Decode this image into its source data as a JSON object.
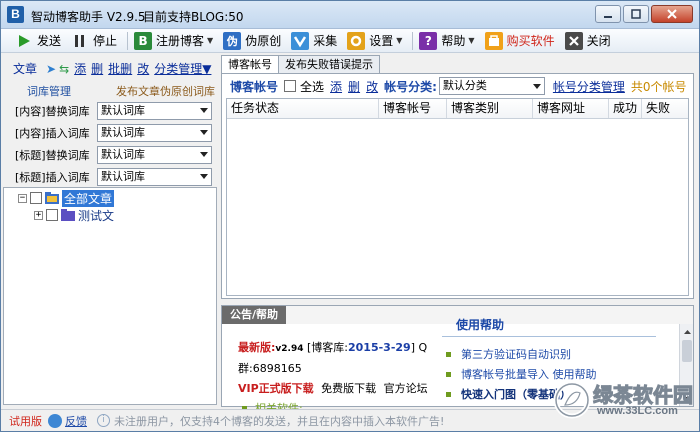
{
  "window": {
    "title": "智动博客助手 V2.9.5",
    "subtitle": "目前支持BLOG:50",
    "icon_letter": "B"
  },
  "toolbar": {
    "send": "发送",
    "stop": "停止",
    "register": "注册博客",
    "pseudo": "伪原创",
    "collect": "采集",
    "settings": "设置",
    "help": "帮助",
    "buy": "购买软件",
    "close": "关闭"
  },
  "left": {
    "article_label": "文章",
    "add": "添",
    "delete": "删",
    "batch_delete": "批删",
    "edit": "改",
    "category_manage": "分类管理▼",
    "tab_lib": "词库管理",
    "tab_pseudo": "发布文章伪原创词库",
    "libs": [
      {
        "name": "[内容]替换词库",
        "value": "默认词库"
      },
      {
        "name": "[内容]插入词库",
        "value": "默认词库"
      },
      {
        "name": "[标题]替换词库",
        "value": "默认词库"
      },
      {
        "name": "[标题]插入词库",
        "value": "默认词库"
      }
    ],
    "tree": {
      "root": "全部文章",
      "child": "测试文"
    }
  },
  "right": {
    "tabs": [
      "博客帐号",
      "发布失败错误提示"
    ],
    "acct_label": "博客帐号",
    "select_all": "全选",
    "add": "添",
    "delete": "删",
    "edit": "改",
    "category_label": "帐号分类:",
    "category_value": "默认分类",
    "category_manage": "帐号分类管理",
    "count": "共0个帐号",
    "columns": [
      "任务状态",
      "博客帐号",
      "博客类别",
      "博客网址",
      "成功",
      "失败"
    ]
  },
  "notice": {
    "title": "公告/帮助",
    "help_title": "使用帮助",
    "new_label": "最新版:",
    "new_version": "v2.94",
    "lib_prefix": "[博客库:",
    "lib_date": "2015-3-29",
    "lib_suffix": "] Q",
    "group": "群:6898165",
    "vip": "VIP正式版下载",
    "free": "免费版下载",
    "forum": "官方论坛",
    "related": "相关软件:",
    "help_items": [
      "第三方验证码自动识别",
      "博客帐号批量导入 使用帮助",
      "快速入门图（零基础）"
    ]
  },
  "status": {
    "trial": "试用版",
    "feedback": "反馈",
    "message": "未注册用户，仅支持4个博客的发送，并且在内容中插入本软件广告!"
  },
  "watermark": {
    "text": "绿茶软件园",
    "url": "www.33LC.com"
  }
}
